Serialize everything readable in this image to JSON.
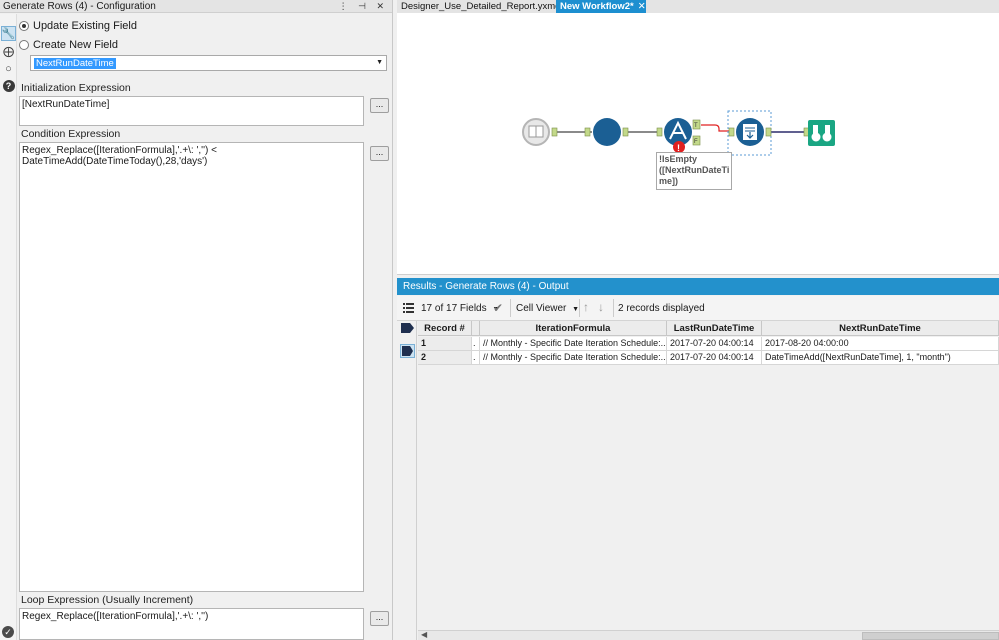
{
  "config": {
    "title": "Generate Rows (4) - Configuration",
    "title_icons": "⋮ ⊣ ✕",
    "update_existing_label": "Update Existing Field",
    "create_new_label": "Create New  Field",
    "selected_field": "NextRunDateTime",
    "init_label": "Initialization Expression",
    "init_expr": "[NextRunDateTime]",
    "cond_label": "Condition Expression",
    "cond_expr": "Regex_Replace([IterationFormula],'.+\\: ','') < DateTimeAdd(DateTimeToday(),28,'days')",
    "loop_label": "Loop Expression (Usually Increment)",
    "loop_expr": "Regex_Replace([IterationFormula],'.+\\: ','')",
    "ellipsis": "..."
  },
  "tabs": [
    {
      "label": "Designer_Use_Detailed_Report.yxmd",
      "close": "✕"
    },
    {
      "label": "New Workflow2*",
      "close": "✕"
    }
  ],
  "canvas": {
    "tooltip": [
      "!IsEmpty",
      "([NextRunDateTi",
      "me])"
    ],
    "anchor_letters": [
      "T",
      "F"
    ]
  },
  "results": {
    "header": "Results - Generate Rows (4) - Output",
    "fields_label": "17 of 17 Fields",
    "viewer_label": "Cell Viewer",
    "records_label": "2 records displayed",
    "columns": [
      "Record #",
      "IterationFormula",
      "LastRunDateTime",
      "NextRunDateTime"
    ],
    "rows": [
      {
        "rec": "1",
        "dot": ".",
        "iter": "// Monthly - Specific Date Iteration Schedule:...",
        "last": "2017-07-20 04:00:14",
        "next": "2017-08-20 04:00:00"
      },
      {
        "rec": "2",
        "dot": ".",
        "iter": "// Monthly - Specific Date Iteration Schedule:...",
        "last": "2017-07-20 04:00:14",
        "next": "DateTimeAdd([NextRunDateTime], 1, \"month\")"
      }
    ]
  },
  "colors": {
    "accent": "#2391cc",
    "tool_blue": "#1b5f94",
    "browse_teal": "#1aa683",
    "anchor_green": "#c3d98a",
    "error_red": "#e02020"
  }
}
